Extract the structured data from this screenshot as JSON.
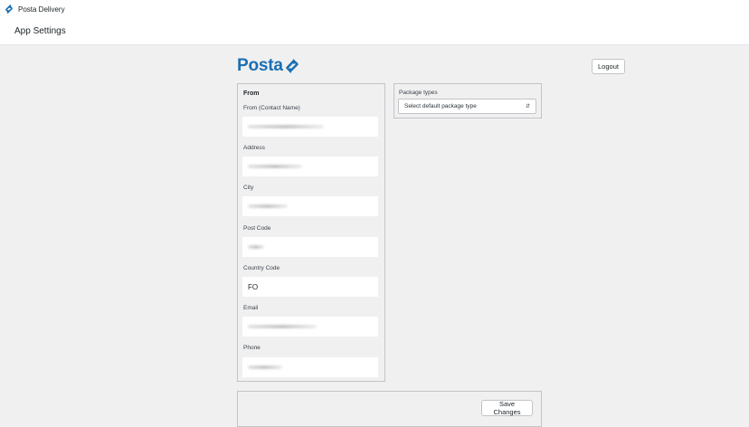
{
  "topbar": {
    "app_name": "Posta Delivery",
    "icon": "posta-arrows-icon"
  },
  "page": {
    "title": "App Settings"
  },
  "brand": {
    "logo_text": "Posta",
    "logo_icon": "posta-arrows-icon",
    "color": "#1a6fb3"
  },
  "header": {
    "logout_label": "Logout"
  },
  "from_section": {
    "heading": "From",
    "fields": [
      {
        "label": "From (Contact Name)",
        "value": ""
      },
      {
        "label": "Address",
        "value": ""
      },
      {
        "label": "City",
        "value": ""
      },
      {
        "label": "Post Code",
        "value": ""
      },
      {
        "label": "Country Code",
        "value": "FO"
      },
      {
        "label": "Email",
        "value": ""
      },
      {
        "label": "Phone",
        "value": ""
      }
    ]
  },
  "package_section": {
    "label": "Package types",
    "select_value": "Select default package type"
  },
  "footer": {
    "save_label": "Save Changes"
  }
}
